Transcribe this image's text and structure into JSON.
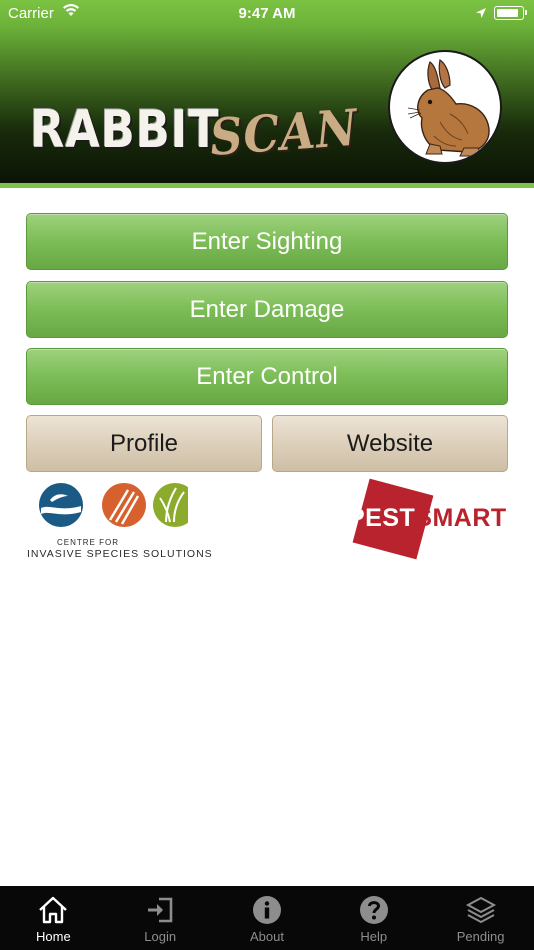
{
  "status_bar": {
    "carrier": "Carrier",
    "time": "9:47 AM",
    "battery_level": 0.9
  },
  "header": {
    "logo_word_1": "RABBIT",
    "logo_word_2": "SCAN",
    "background_color": "#5fa12f",
    "accent_color": "#7ec34a"
  },
  "actions": {
    "enter_sighting": "Enter Sighting",
    "enter_damage": "Enter Damage",
    "enter_control": "Enter Control",
    "profile": "Profile",
    "website": "Website"
  },
  "partners": {
    "cisr_line_1": "CENTRE FOR",
    "cisr_line_2": "INVASIVE SPECIES SOLUTIONS",
    "pestsmart_part_1": "PEST",
    "pestsmart_part_2": "SMART"
  },
  "tabbar": {
    "items": [
      {
        "label": "Home",
        "icon": "home-icon",
        "active": true
      },
      {
        "label": "Login",
        "icon": "login-icon",
        "active": false
      },
      {
        "label": "About",
        "icon": "info-icon",
        "active": false
      },
      {
        "label": "Help",
        "icon": "help-icon",
        "active": false
      },
      {
        "label": "Pending",
        "icon": "layers-icon",
        "active": false
      }
    ]
  },
  "colors": {
    "button_green": "#7fbf5a",
    "button_tan": "#ddd0bb",
    "pestsmart_red": "#b8232d",
    "tabbar_bg": "#080808"
  }
}
